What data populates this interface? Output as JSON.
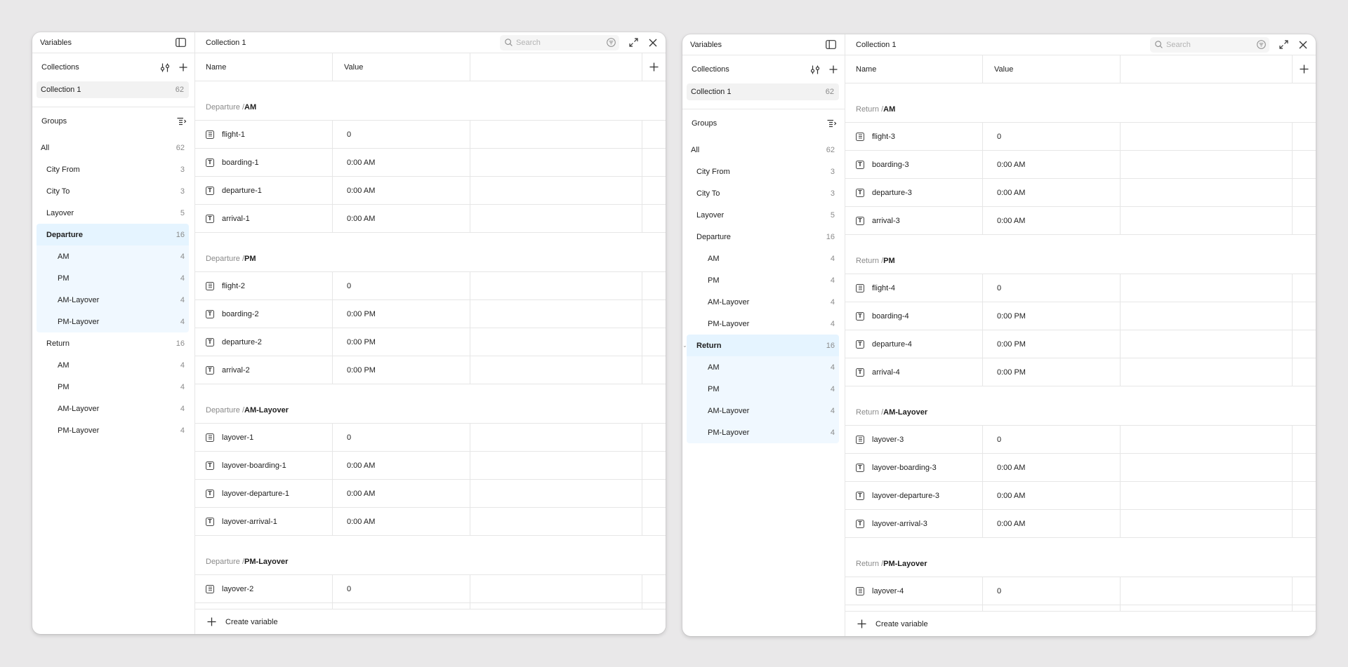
{
  "panels": [
    {
      "sidebar": {
        "title": "Variables",
        "collections_label": "Collections",
        "collection": {
          "label": "Collection 1",
          "count": "62"
        },
        "groups_label": "Groups",
        "groups": [
          {
            "label": "All",
            "count": "62",
            "level": 0,
            "state": ""
          },
          {
            "label": "City From",
            "count": "3",
            "level": 1,
            "state": ""
          },
          {
            "label": "City To",
            "count": "3",
            "level": 1,
            "state": ""
          },
          {
            "label": "Layover",
            "count": "5",
            "level": 1,
            "state": ""
          },
          {
            "label": "Departure",
            "count": "16",
            "level": 1,
            "state": "sel"
          },
          {
            "label": "AM",
            "count": "4",
            "level": 2,
            "state": "selchild"
          },
          {
            "label": "PM",
            "count": "4",
            "level": 2,
            "state": "selchild"
          },
          {
            "label": "AM-Layover",
            "count": "4",
            "level": 2,
            "state": "selchild"
          },
          {
            "label": "PM-Layover",
            "count": "4",
            "level": 2,
            "state": "selchild last"
          },
          {
            "label": "Return",
            "count": "16",
            "level": 1,
            "state": ""
          },
          {
            "label": "AM",
            "count": "4",
            "level": 2,
            "state": ""
          },
          {
            "label": "PM",
            "count": "4",
            "level": 2,
            "state": ""
          },
          {
            "label": "AM-Layover",
            "count": "4",
            "level": 2,
            "state": ""
          },
          {
            "label": "PM-Layover",
            "count": "4",
            "level": 2,
            "state": ""
          }
        ]
      },
      "main": {
        "title": "Collection 1",
        "search_placeholder": "Search",
        "columns": {
          "name": "Name",
          "value": "Value"
        },
        "groups": [
          {
            "prefix": "Departure / ",
            "name": "AM",
            "rows": [
              {
                "icon": "num",
                "name": "flight-1",
                "value": "0"
              },
              {
                "icon": "text",
                "name": "boarding-1",
                "value": "0:00 AM"
              },
              {
                "icon": "text",
                "name": "departure-1",
                "value": "0:00 AM"
              },
              {
                "icon": "text",
                "name": "arrival-1",
                "value": "0:00 AM"
              }
            ]
          },
          {
            "prefix": "Departure / ",
            "name": "PM",
            "rows": [
              {
                "icon": "num",
                "name": "flight-2",
                "value": "0"
              },
              {
                "icon": "text",
                "name": "boarding-2",
                "value": "0:00 PM"
              },
              {
                "icon": "text",
                "name": "departure-2",
                "value": "0:00 PM"
              },
              {
                "icon": "text",
                "name": "arrival-2",
                "value": "0:00 PM"
              }
            ]
          },
          {
            "prefix": "Departure / ",
            "name": "AM-Layover",
            "rows": [
              {
                "icon": "num",
                "name": "layover-1",
                "value": "0"
              },
              {
                "icon": "text",
                "name": "layover-boarding-1",
                "value": "0:00 AM"
              },
              {
                "icon": "text",
                "name": "layover-departure-1",
                "value": "0:00 AM"
              },
              {
                "icon": "text",
                "name": "layover-arrival-1",
                "value": "0:00 AM"
              }
            ]
          },
          {
            "prefix": "Departure / ",
            "name": "PM-Layover",
            "rows": [
              {
                "icon": "num",
                "name": "layover-2",
                "value": "0"
              },
              {
                "icon": "text",
                "name": "",
                "value": ""
              }
            ]
          }
        ],
        "footer": {
          "create_label": "Create variable"
        }
      }
    },
    {
      "sidebar": {
        "title": "Variables",
        "collections_label": "Collections",
        "collection": {
          "label": "Collection 1",
          "count": "62"
        },
        "groups_label": "Groups",
        "groups": [
          {
            "label": "All",
            "count": "62",
            "level": 0,
            "state": ""
          },
          {
            "label": "City From",
            "count": "3",
            "level": 1,
            "state": ""
          },
          {
            "label": "City To",
            "count": "3",
            "level": 1,
            "state": ""
          },
          {
            "label": "Layover",
            "count": "5",
            "level": 1,
            "state": ""
          },
          {
            "label": "Departure",
            "count": "16",
            "level": 1,
            "state": ""
          },
          {
            "label": "AM",
            "count": "4",
            "level": 2,
            "state": ""
          },
          {
            "label": "PM",
            "count": "4",
            "level": 2,
            "state": ""
          },
          {
            "label": "AM-Layover",
            "count": "4",
            "level": 2,
            "state": ""
          },
          {
            "label": "PM-Layover",
            "count": "4",
            "level": 2,
            "state": ""
          },
          {
            "label": "Return",
            "count": "16",
            "level": 1,
            "state": "sel"
          },
          {
            "label": "AM",
            "count": "4",
            "level": 2,
            "state": "selchild"
          },
          {
            "label": "PM",
            "count": "4",
            "level": 2,
            "state": "selchild"
          },
          {
            "label": "AM-Layover",
            "count": "4",
            "level": 2,
            "state": "selchild"
          },
          {
            "label": "PM-Layover",
            "count": "4",
            "level": 2,
            "state": "selchild last"
          }
        ]
      },
      "main": {
        "title": "Collection 1",
        "search_placeholder": "Search",
        "columns": {
          "name": "Name",
          "value": "Value"
        },
        "groups": [
          {
            "prefix": "Return / ",
            "name": "AM",
            "rows": [
              {
                "icon": "num",
                "name": "flight-3",
                "value": "0"
              },
              {
                "icon": "text",
                "name": "boarding-3",
                "value": "0:00 AM"
              },
              {
                "icon": "text",
                "name": "departure-3",
                "value": "0:00 AM"
              },
              {
                "icon": "text",
                "name": "arrival-3",
                "value": "0:00 AM"
              }
            ]
          },
          {
            "prefix": "Return / ",
            "name": "PM",
            "rows": [
              {
                "icon": "num",
                "name": "flight-4",
                "value": "0"
              },
              {
                "icon": "text",
                "name": "boarding-4",
                "value": "0:00 PM"
              },
              {
                "icon": "text",
                "name": "departure-4",
                "value": "0:00 PM"
              },
              {
                "icon": "text",
                "name": "arrival-4",
                "value": "0:00 PM"
              }
            ]
          },
          {
            "prefix": "Return / ",
            "name": "AM-Layover",
            "rows": [
              {
                "icon": "num",
                "name": "layover-3",
                "value": "0"
              },
              {
                "icon": "text",
                "name": "layover-boarding-3",
                "value": "0:00 AM"
              },
              {
                "icon": "text",
                "name": "layover-departure-3",
                "value": "0:00 AM"
              },
              {
                "icon": "text",
                "name": "layover-arrival-3",
                "value": "0:00 AM"
              }
            ]
          },
          {
            "prefix": "Return / ",
            "name": "PM-Layover",
            "rows": [
              {
                "icon": "num",
                "name": "layover-4",
                "value": "0"
              },
              {
                "icon": "text",
                "name": "",
                "value": ""
              }
            ]
          }
        ],
        "footer": {
          "create_label": "Create variable"
        }
      }
    }
  ]
}
